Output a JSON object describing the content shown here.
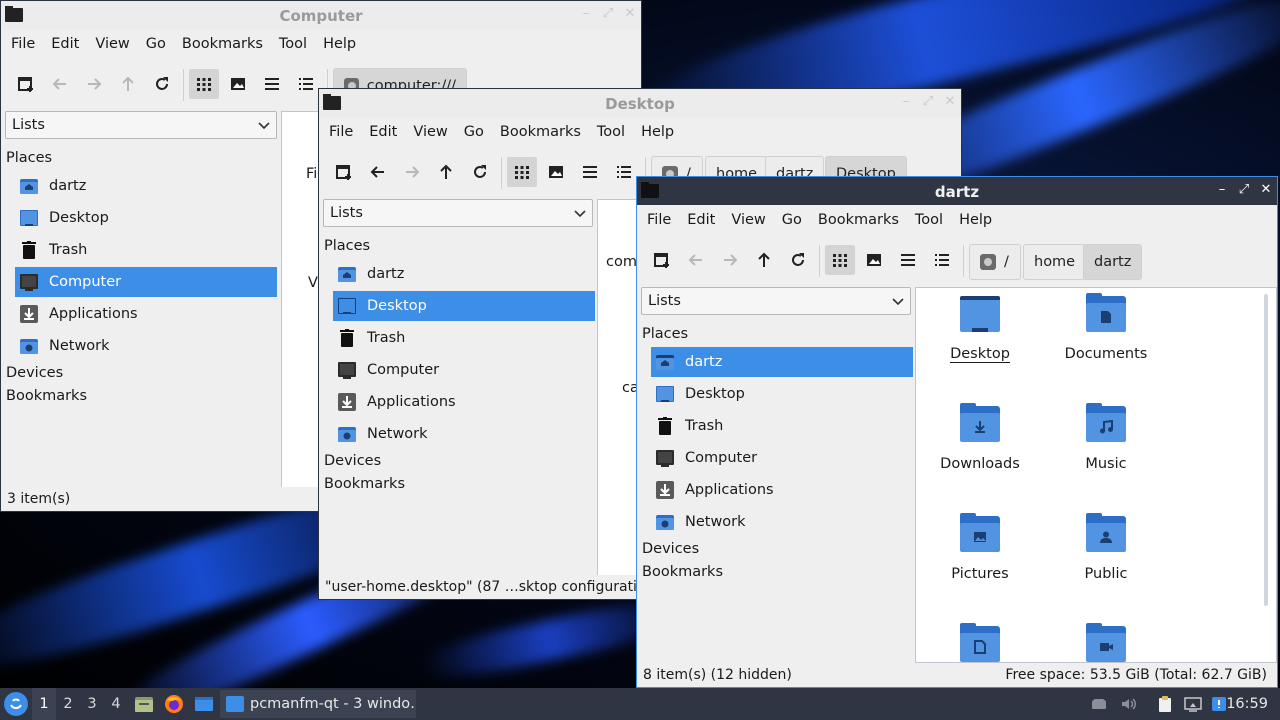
{
  "menu": [
    "File",
    "Edit",
    "View",
    "Go",
    "Bookmarks",
    "Tool",
    "Help"
  ],
  "side_view_mode": "Lists",
  "places_header": "Places",
  "devices_header": "Devices",
  "bookmarks_header": "Bookmarks",
  "places": [
    "dartz",
    "Desktop",
    "Trash",
    "Computer",
    "Applications",
    "Network"
  ],
  "computer_window": {
    "title": "Computer",
    "path": "computer:///",
    "selected_place": "Computer",
    "content_partial": [
      "Fi",
      "V"
    ],
    "status": "3 item(s)"
  },
  "desktop_window": {
    "title": "Desktop",
    "breadcrumb": [
      "/",
      "home",
      "dartz",
      "Desktop"
    ],
    "selected_place": "Desktop",
    "content_partial": [
      "comp",
      "ca"
    ],
    "status": "\"user-home.desktop\" (87 …sktop configuratio"
  },
  "dartz_window": {
    "title": "dartz",
    "breadcrumb": [
      "/",
      "home",
      "dartz"
    ],
    "selected_place": "dartz",
    "files": [
      {
        "name": "Desktop",
        "icon": "desktop-folder-icon"
      },
      {
        "name": "Documents",
        "icon": "documents-folder-icon"
      },
      {
        "name": "Downloads",
        "icon": "downloads-folder-icon"
      },
      {
        "name": "Music",
        "icon": "music-folder-icon"
      },
      {
        "name": "Pictures",
        "icon": "pictures-folder-icon"
      },
      {
        "name": "Public",
        "icon": "public-folder-icon"
      },
      {
        "name": "",
        "icon": "templates-folder-icon"
      },
      {
        "name": "",
        "icon": "videos-folder-icon"
      }
    ],
    "status_left": "8 item(s) (12 hidden)",
    "status_right": "Free space: 53.5 GiB (Total: 62.7 GiB)"
  },
  "taskbar": {
    "workspaces": [
      "1",
      "2",
      "3",
      "4"
    ],
    "current_workspace": "1",
    "task_label": "pcmanfm-qt - 3 windo…",
    "clock": "16:59"
  },
  "colors": {
    "accent": "#3d8ee6",
    "titlebar_active": "#2f3542",
    "folder_front": "#5294e2",
    "folder_back": "#2d6fc7",
    "panel": "#efefef"
  }
}
